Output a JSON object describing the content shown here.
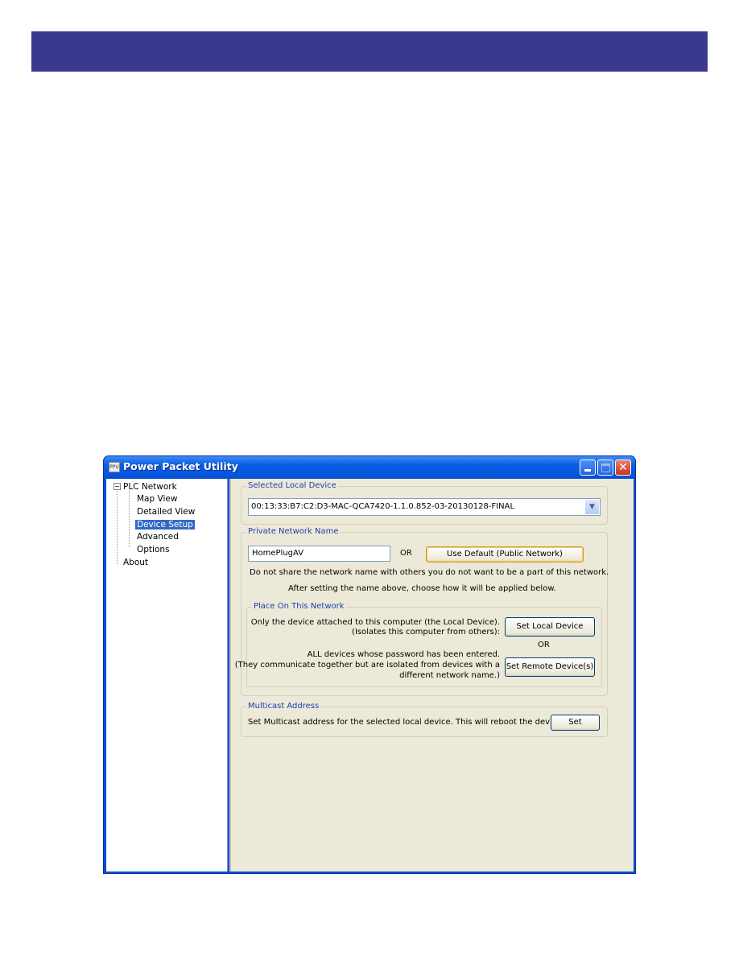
{
  "window": {
    "title": "Power Packet Utility",
    "icon_text": "PPU"
  },
  "tree": {
    "root": "PLC Network",
    "items": [
      "Map View",
      "Detailed View",
      "Device Setup",
      "Advanced",
      "Options"
    ],
    "selected": "Device Setup",
    "about": "About"
  },
  "local_device": {
    "legend": "Selected Local Device",
    "value": "00:13:33:B7:C2:D3-MAC-QCA7420-1.1.0.852-03-20130128-FINAL"
  },
  "private_network": {
    "legend": "Private Network Name",
    "input_value": "HomePlugAV",
    "or": "OR",
    "default_button": "Use Default (Public Network)",
    "note1": "Do not share the network name with others you do not want to be a part of this network.",
    "note2": "After setting the name above, choose how it will be applied below."
  },
  "place": {
    "legend": "Place On This Network",
    "local_line1": "Only the device attached to this computer (the Local Device).",
    "local_line2": "(Isolates this computer from others):",
    "local_button": "Set Local Device",
    "or": "OR",
    "remote_line1": "ALL devices whose password has been entered.",
    "remote_line2": "(They communicate together but are isolated from devices with a",
    "remote_line3": "different network name.)",
    "remote_button": "Set Remote Device(s)"
  },
  "multicast": {
    "legend": "Multicast Address",
    "text": "Set Multicast address for the selected local device. This will reboot the device.",
    "button": "Set"
  },
  "colors": {
    "header_band": "#3a3990",
    "titlebar": "#0a5fe0",
    "panel": "#ece9d8",
    "selection": "#316ac5"
  }
}
